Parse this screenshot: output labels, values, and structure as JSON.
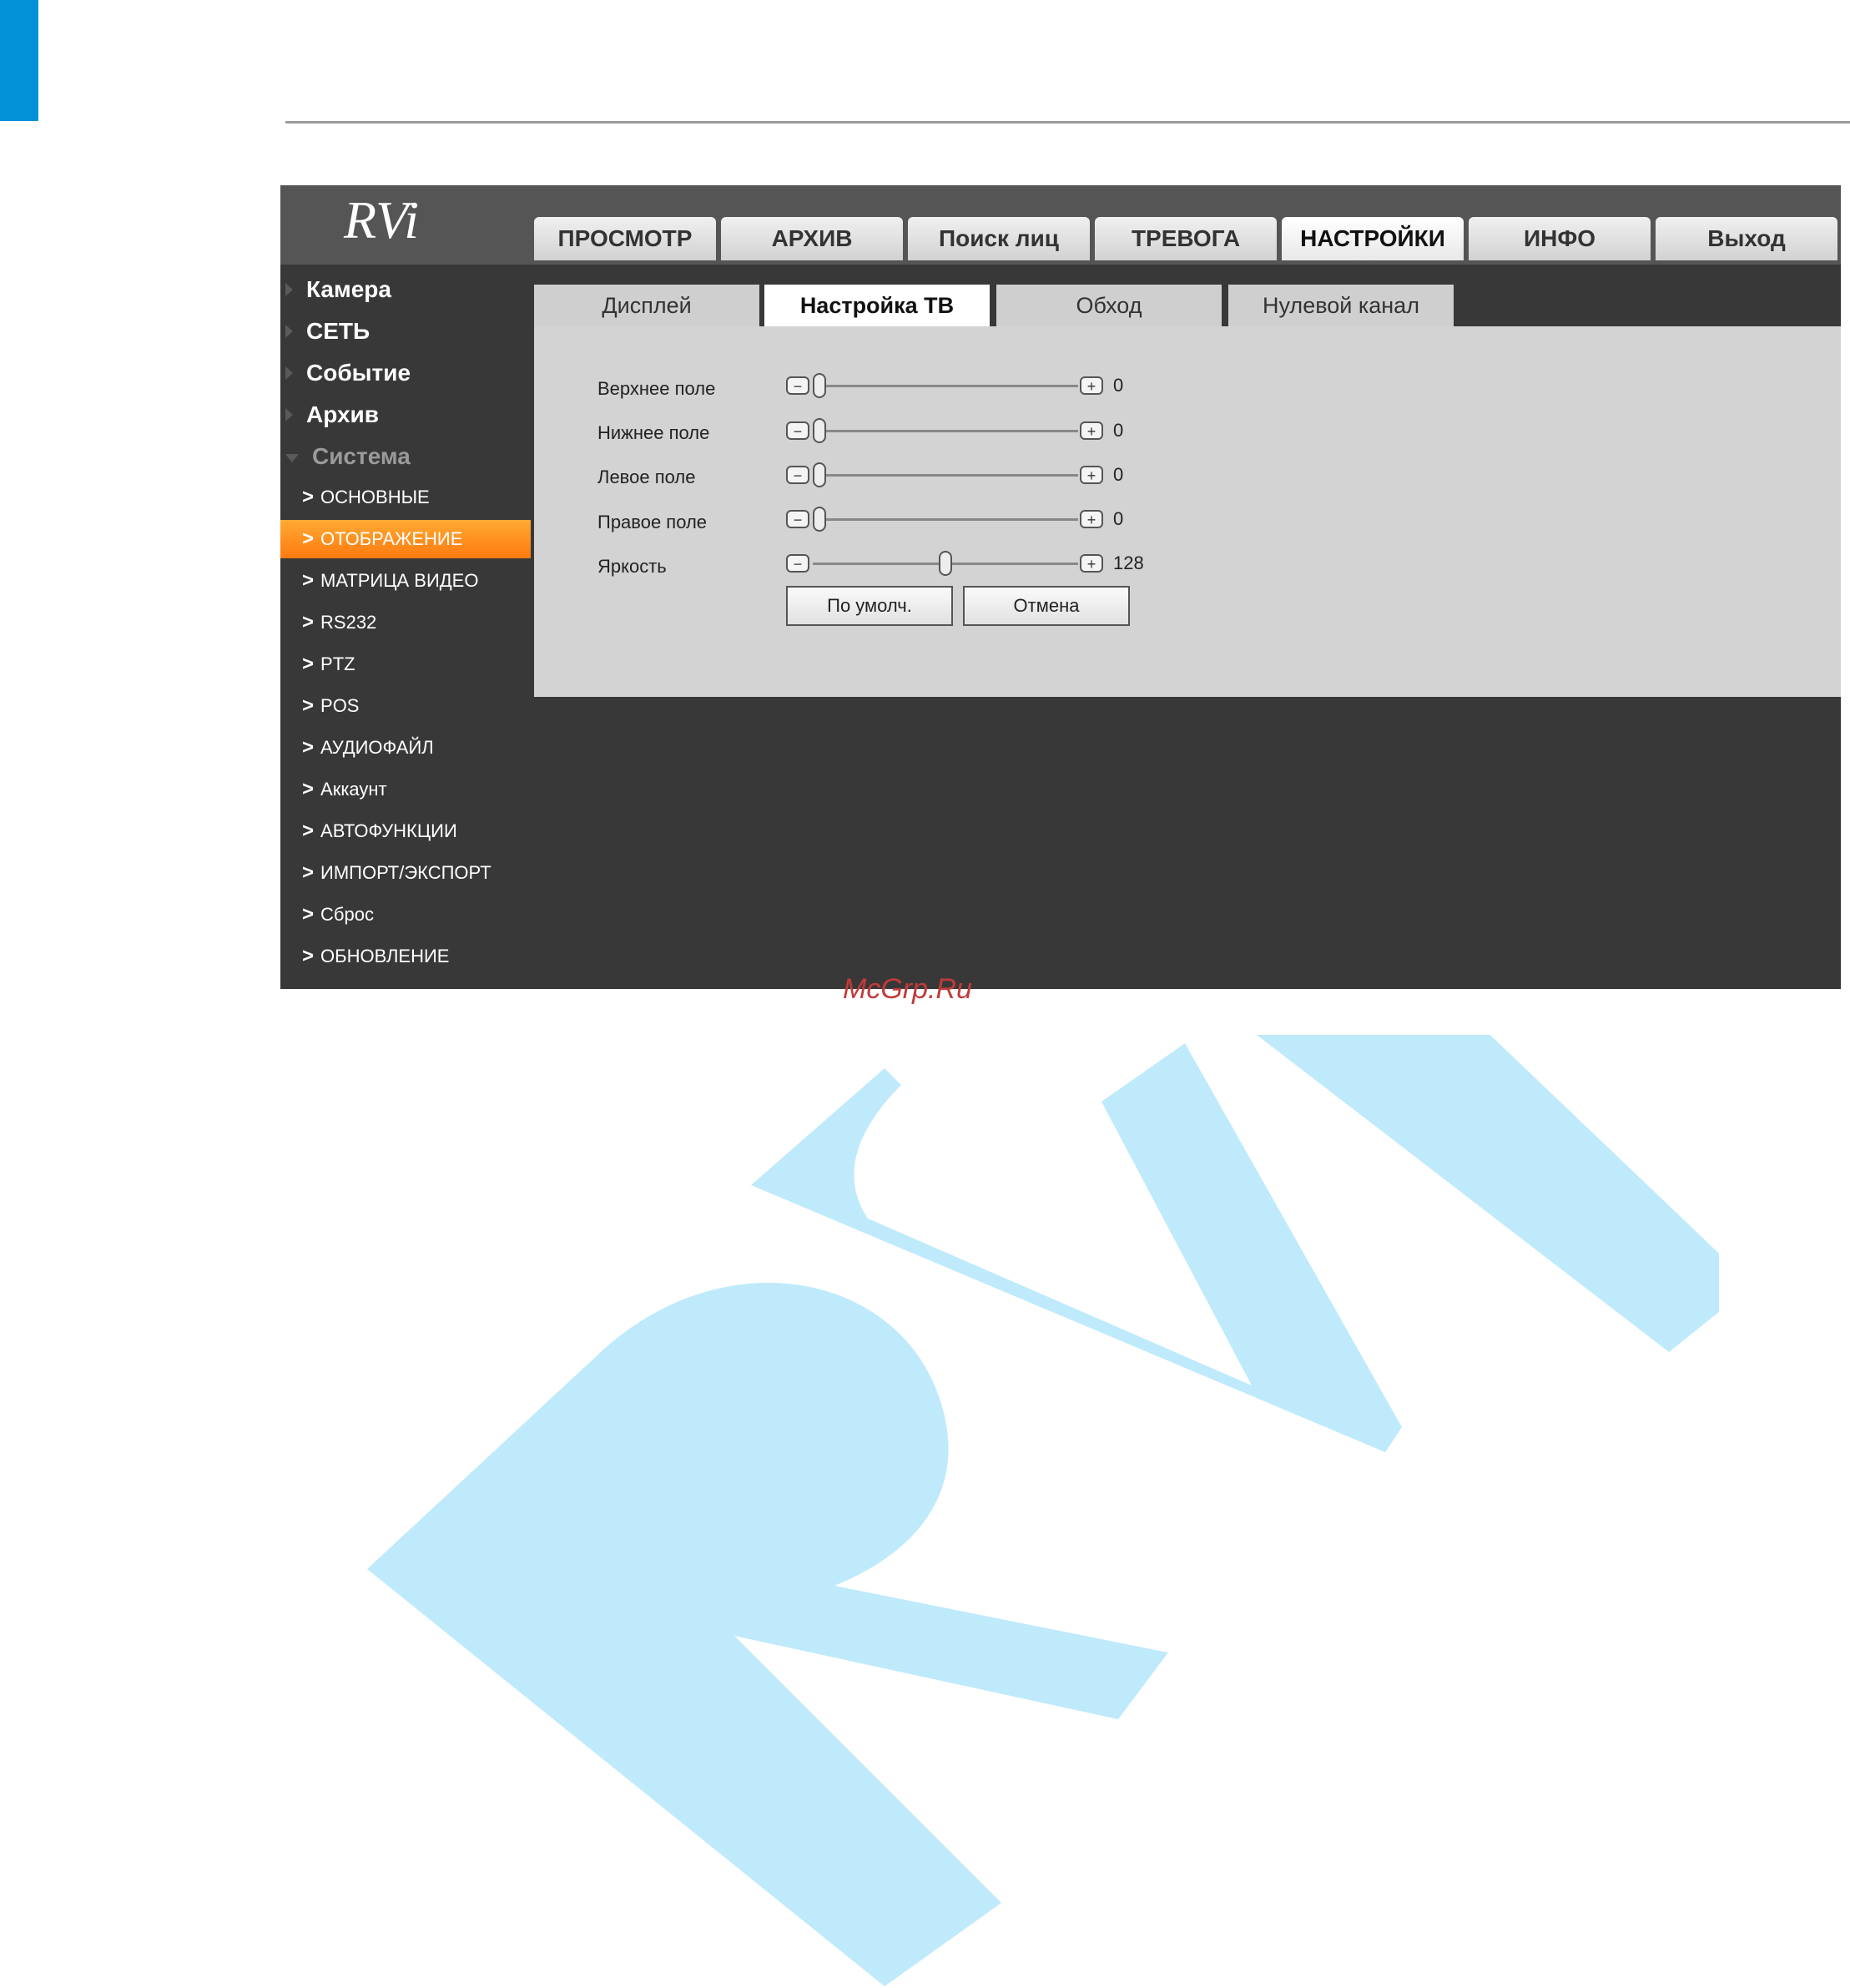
{
  "main_tabs": [
    {
      "label": "ПРОСМОТР"
    },
    {
      "label": "АРХИВ"
    },
    {
      "label": "Поиск лиц"
    },
    {
      "label": "ТРЕВОГА"
    },
    {
      "label": "НАСТРОЙКИ",
      "active": true
    },
    {
      "label": "ИНФО"
    },
    {
      "label": "Выход"
    }
  ],
  "logo_text": "RVi",
  "sidebar": {
    "categories": [
      {
        "label": "Камера"
      },
      {
        "label": "СЕТЬ"
      },
      {
        "label": "Событие"
      },
      {
        "label": "Архив"
      },
      {
        "label": "Система",
        "expanded": true
      }
    ],
    "items": [
      {
        "label": "ОСНОВНЫЕ"
      },
      {
        "label": "ОТОБРАЖЕНИЕ",
        "active": true
      },
      {
        "label": "МАТРИЦА ВИДЕО"
      },
      {
        "label": "RS232"
      },
      {
        "label": "PTZ"
      },
      {
        "label": "POS"
      },
      {
        "label": "АУДИОФАЙЛ"
      },
      {
        "label": "Аккаунт"
      },
      {
        "label": "АВТОФУНКЦИИ"
      },
      {
        "label": "ИМПОРТ/ЭКСПОРТ"
      },
      {
        "label": "Сброс"
      },
      {
        "label": "ОБНОВЛЕНИЕ"
      }
    ]
  },
  "sub_tabs": [
    {
      "label": "Дисплей"
    },
    {
      "label": "Настройка ТВ",
      "active": true
    },
    {
      "label": "Обход"
    },
    {
      "label": "Нулевой канал"
    }
  ],
  "settings": [
    {
      "label": "Верхнее поле",
      "value": "0",
      "fraction": 0.0
    },
    {
      "label": "Нижнее поле",
      "value": "0",
      "fraction": 0.0
    },
    {
      "label": "Левое поле",
      "value": "0",
      "fraction": 0.0
    },
    {
      "label": "Правое поле",
      "value": "0",
      "fraction": 0.0
    },
    {
      "label": "Яркость",
      "value": "128",
      "fraction": 0.5
    }
  ],
  "buttons": {
    "default_label": "По умолч.",
    "cancel_label": "Отмена"
  },
  "watermark_text": "McGrp.Ru",
  "colors": {
    "accent_orange": "#ff8a1a",
    "brand_blue": "#0091d6",
    "watermark_blue": "#bfeafc"
  }
}
